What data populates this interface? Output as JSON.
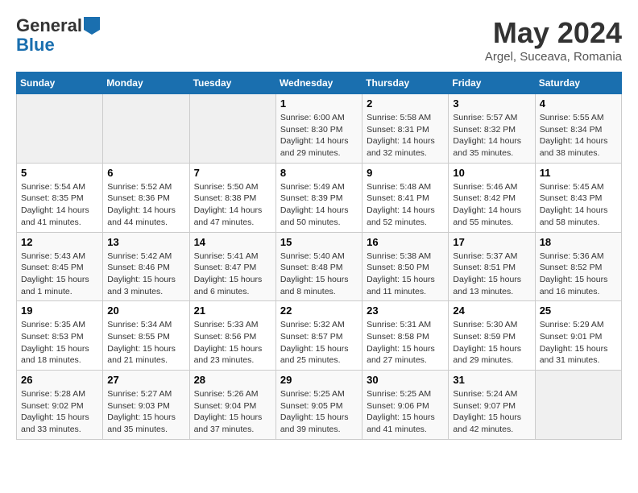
{
  "logo": {
    "general": "General",
    "blue": "Blue"
  },
  "header": {
    "month": "May 2024",
    "location": "Argel, Suceava, Romania"
  },
  "weekdays": [
    "Sunday",
    "Monday",
    "Tuesday",
    "Wednesday",
    "Thursday",
    "Friday",
    "Saturday"
  ],
  "weeks": [
    [
      {
        "day": "",
        "detail": ""
      },
      {
        "day": "",
        "detail": ""
      },
      {
        "day": "",
        "detail": ""
      },
      {
        "day": "1",
        "detail": "Sunrise: 6:00 AM\nSunset: 8:30 PM\nDaylight: 14 hours\nand 29 minutes."
      },
      {
        "day": "2",
        "detail": "Sunrise: 5:58 AM\nSunset: 8:31 PM\nDaylight: 14 hours\nand 32 minutes."
      },
      {
        "day": "3",
        "detail": "Sunrise: 5:57 AM\nSunset: 8:32 PM\nDaylight: 14 hours\nand 35 minutes."
      },
      {
        "day": "4",
        "detail": "Sunrise: 5:55 AM\nSunset: 8:34 PM\nDaylight: 14 hours\nand 38 minutes."
      }
    ],
    [
      {
        "day": "5",
        "detail": "Sunrise: 5:54 AM\nSunset: 8:35 PM\nDaylight: 14 hours\nand 41 minutes."
      },
      {
        "day": "6",
        "detail": "Sunrise: 5:52 AM\nSunset: 8:36 PM\nDaylight: 14 hours\nand 44 minutes."
      },
      {
        "day": "7",
        "detail": "Sunrise: 5:50 AM\nSunset: 8:38 PM\nDaylight: 14 hours\nand 47 minutes."
      },
      {
        "day": "8",
        "detail": "Sunrise: 5:49 AM\nSunset: 8:39 PM\nDaylight: 14 hours\nand 50 minutes."
      },
      {
        "day": "9",
        "detail": "Sunrise: 5:48 AM\nSunset: 8:41 PM\nDaylight: 14 hours\nand 52 minutes."
      },
      {
        "day": "10",
        "detail": "Sunrise: 5:46 AM\nSunset: 8:42 PM\nDaylight: 14 hours\nand 55 minutes."
      },
      {
        "day": "11",
        "detail": "Sunrise: 5:45 AM\nSunset: 8:43 PM\nDaylight: 14 hours\nand 58 minutes."
      }
    ],
    [
      {
        "day": "12",
        "detail": "Sunrise: 5:43 AM\nSunset: 8:45 PM\nDaylight: 15 hours\nand 1 minute."
      },
      {
        "day": "13",
        "detail": "Sunrise: 5:42 AM\nSunset: 8:46 PM\nDaylight: 15 hours\nand 3 minutes."
      },
      {
        "day": "14",
        "detail": "Sunrise: 5:41 AM\nSunset: 8:47 PM\nDaylight: 15 hours\nand 6 minutes."
      },
      {
        "day": "15",
        "detail": "Sunrise: 5:40 AM\nSunset: 8:48 PM\nDaylight: 15 hours\nand 8 minutes."
      },
      {
        "day": "16",
        "detail": "Sunrise: 5:38 AM\nSunset: 8:50 PM\nDaylight: 15 hours\nand 11 minutes."
      },
      {
        "day": "17",
        "detail": "Sunrise: 5:37 AM\nSunset: 8:51 PM\nDaylight: 15 hours\nand 13 minutes."
      },
      {
        "day": "18",
        "detail": "Sunrise: 5:36 AM\nSunset: 8:52 PM\nDaylight: 15 hours\nand 16 minutes."
      }
    ],
    [
      {
        "day": "19",
        "detail": "Sunrise: 5:35 AM\nSunset: 8:53 PM\nDaylight: 15 hours\nand 18 minutes."
      },
      {
        "day": "20",
        "detail": "Sunrise: 5:34 AM\nSunset: 8:55 PM\nDaylight: 15 hours\nand 21 minutes."
      },
      {
        "day": "21",
        "detail": "Sunrise: 5:33 AM\nSunset: 8:56 PM\nDaylight: 15 hours\nand 23 minutes."
      },
      {
        "day": "22",
        "detail": "Sunrise: 5:32 AM\nSunset: 8:57 PM\nDaylight: 15 hours\nand 25 minutes."
      },
      {
        "day": "23",
        "detail": "Sunrise: 5:31 AM\nSunset: 8:58 PM\nDaylight: 15 hours\nand 27 minutes."
      },
      {
        "day": "24",
        "detail": "Sunrise: 5:30 AM\nSunset: 8:59 PM\nDaylight: 15 hours\nand 29 minutes."
      },
      {
        "day": "25",
        "detail": "Sunrise: 5:29 AM\nSunset: 9:01 PM\nDaylight: 15 hours\nand 31 minutes."
      }
    ],
    [
      {
        "day": "26",
        "detail": "Sunrise: 5:28 AM\nSunset: 9:02 PM\nDaylight: 15 hours\nand 33 minutes."
      },
      {
        "day": "27",
        "detail": "Sunrise: 5:27 AM\nSunset: 9:03 PM\nDaylight: 15 hours\nand 35 minutes."
      },
      {
        "day": "28",
        "detail": "Sunrise: 5:26 AM\nSunset: 9:04 PM\nDaylight: 15 hours\nand 37 minutes."
      },
      {
        "day": "29",
        "detail": "Sunrise: 5:25 AM\nSunset: 9:05 PM\nDaylight: 15 hours\nand 39 minutes."
      },
      {
        "day": "30",
        "detail": "Sunrise: 5:25 AM\nSunset: 9:06 PM\nDaylight: 15 hours\nand 41 minutes."
      },
      {
        "day": "31",
        "detail": "Sunrise: 5:24 AM\nSunset: 9:07 PM\nDaylight: 15 hours\nand 42 minutes."
      },
      {
        "day": "",
        "detail": ""
      }
    ]
  ]
}
